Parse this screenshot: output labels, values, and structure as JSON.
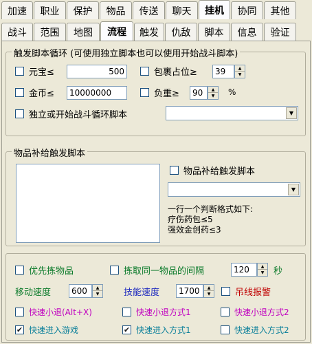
{
  "tabs_row1": [
    "加速",
    "职业",
    "保护",
    "物品",
    "传送",
    "聊天",
    "挂机",
    "协同",
    "其他"
  ],
  "tabs_row2": [
    "战斗",
    "范围",
    "地图",
    "流程",
    "触发",
    "仇敌",
    "脚本",
    "信息",
    "验证"
  ],
  "active_tabs": {
    "row1": "挂机",
    "row2": "流程"
  },
  "loop_group": {
    "title": "触发脚本循环 (可使用独立脚本也可以使用开始战斗脚本)",
    "yuanbao_label": "元宝≤",
    "yuanbao_value": "500",
    "bag_label": "包裹占位≥",
    "bag_value": "39",
    "gold_label": "金币≤",
    "gold_value": "10000000",
    "weight_label": "负重≥",
    "weight_value": "90",
    "weight_unit": "%",
    "script_label": "独立或开始战斗循环脚本",
    "script_select": ""
  },
  "supply_group": {
    "title": "物品补给触发脚本",
    "checkbox_label": "物品补给触发脚本",
    "select_value": "",
    "note_lines": [
      "一行一个判断格式如下:",
      "疗伤药包≤5",
      "强效金创药≤3"
    ]
  },
  "options": {
    "priority_pick": "优先拣物品",
    "pick_interval_label": "拣取同一物品的间隔",
    "pick_interval_value": "120",
    "pick_interval_unit": "秒",
    "move_speed_label": "移动速度",
    "move_speed_value": "600",
    "skill_speed_label": "技能速度",
    "skill_speed_value": "1700",
    "alarm_label": "吊线报警",
    "quick_exit": "快速小退(Alt+X)",
    "quick_exit_1": "快速小退方式1",
    "quick_exit_2": "快速小退方式2",
    "quick_enter": "快速进入游戏",
    "quick_enter_1": "快速进入方式1",
    "quick_enter_2": "快速进入方式2"
  },
  "checked": {
    "yuanbao": false,
    "bag": false,
    "gold": false,
    "weight": false,
    "script": false,
    "supply": false,
    "priority_pick": false,
    "pick_interval": false,
    "alarm": false,
    "quick_exit": false,
    "quick_exit_1": false,
    "quick_exit_2": false,
    "quick_enter": true,
    "quick_enter_1": true,
    "quick_enter_2": false
  },
  "colors": {
    "green": "#0a7a2a",
    "blue": "#1f2bbf",
    "red": "#c00000",
    "magenta": "#c000c0",
    "teal": "#0a7f9a"
  }
}
